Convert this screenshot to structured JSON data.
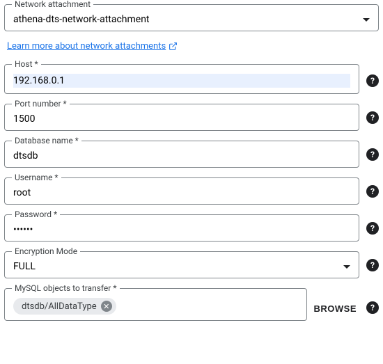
{
  "network_attachment": {
    "label": "Network attachment",
    "value": "athena-dts-network-attachment"
  },
  "link": {
    "text": "Learn more about network attachments"
  },
  "host": {
    "label": "Host *",
    "value": "192.168.0.1"
  },
  "port": {
    "label": "Port number *",
    "value": "1500"
  },
  "database": {
    "label": "Database name *",
    "value": "dtsdb"
  },
  "username": {
    "label": "Username *",
    "value": "root"
  },
  "password": {
    "label": "Password *",
    "value": "••••••"
  },
  "encryption": {
    "label": "Encryption Mode",
    "value": "FULL"
  },
  "objects": {
    "label": "MySQL objects to transfer *",
    "chips": [
      "dtsdb/AllDataType"
    ],
    "browse": "BROWSE"
  },
  "help_glyph": "?"
}
